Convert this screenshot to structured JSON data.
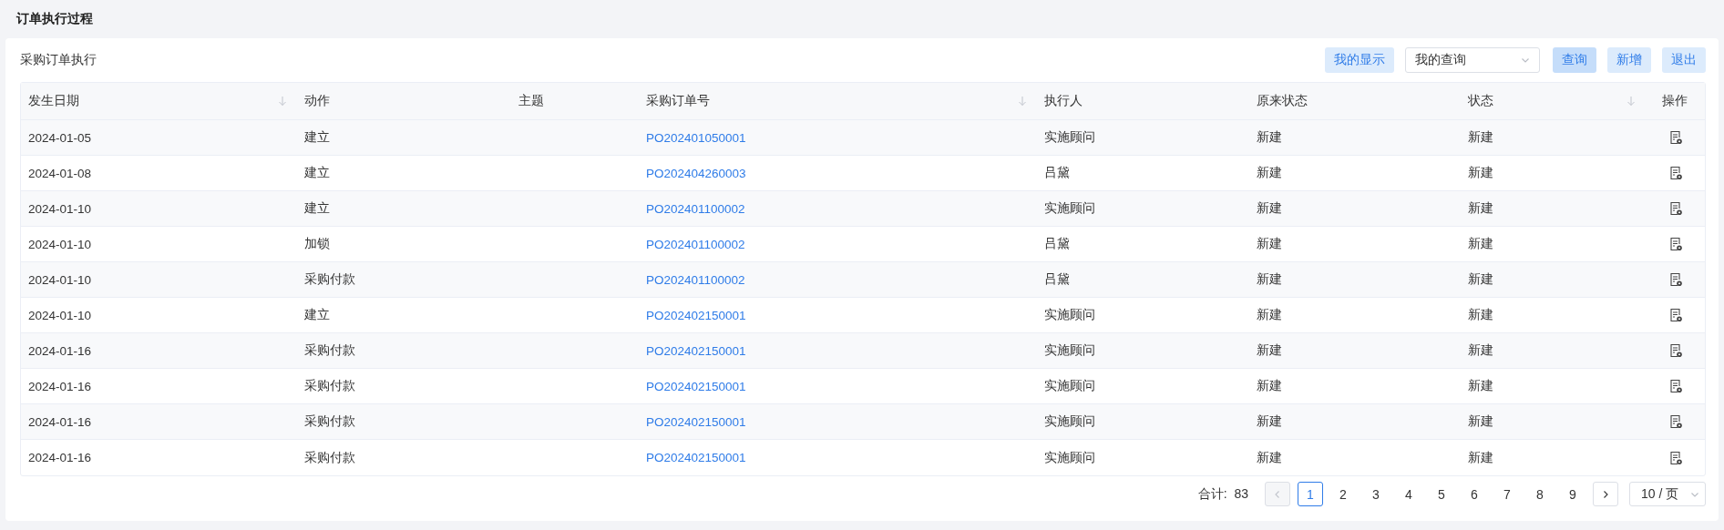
{
  "page_title": "订单执行过程",
  "panel": {
    "title": "采购订单执行",
    "toolbar": [
      {
        "kind": "button",
        "label": "我的显示",
        "selected": false
      },
      {
        "kind": "select",
        "value": "我的查询"
      },
      {
        "kind": "button",
        "label": "查询",
        "selected": true
      },
      {
        "kind": "button",
        "label": "新增",
        "selected": false
      },
      {
        "kind": "button",
        "label": "退出",
        "selected": false
      }
    ]
  },
  "table": {
    "columns": [
      {
        "label": "发生日期",
        "sortable": true
      },
      {
        "label": "动作",
        "sortable": false
      },
      {
        "label": "主题",
        "sortable": false
      },
      {
        "label": "采购订单号",
        "sortable": true
      },
      {
        "label": "执行人",
        "sortable": false
      },
      {
        "label": "原来状态",
        "sortable": false
      },
      {
        "label": "状态",
        "sortable": true
      },
      {
        "label": "操作",
        "sortable": false
      }
    ],
    "rows": [
      {
        "date": "2024-01-05",
        "action": "建立",
        "order_no": "PO202401050001",
        "executor": "实施顾问",
        "previous_status": "新建",
        "status": "新建"
      },
      {
        "date": "2024-01-08",
        "action": "建立",
        "order_no": "PO202404260003",
        "executor": "吕黛",
        "previous_status": "新建",
        "status": "新建"
      },
      {
        "date": "2024-01-10",
        "action": "建立",
        "order_no": "PO202401100002",
        "executor": "实施顾问",
        "previous_status": "新建",
        "status": "新建"
      },
      {
        "date": "2024-01-10",
        "action": "加锁",
        "order_no": "PO202401100002",
        "executor": "吕黛",
        "previous_status": "新建",
        "status": "新建"
      },
      {
        "date": "2024-01-10",
        "action": "采购付款",
        "order_no": "PO202401100002",
        "executor": "吕黛",
        "previous_status": "新建",
        "status": "新建"
      },
      {
        "date": "2024-01-10",
        "action": "建立",
        "order_no": "PO202402150001",
        "executor": "实施顾问",
        "previous_status": "新建",
        "status": "新建"
      },
      {
        "date": "2024-01-16",
        "action": "采购付款",
        "order_no": "PO202402150001",
        "executor": "实施顾问",
        "previous_status": "新建",
        "status": "新建"
      },
      {
        "date": "2024-01-16",
        "action": "采购付款",
        "order_no": "PO202402150001",
        "executor": "实施顾问",
        "previous_status": "新建",
        "status": "新建"
      },
      {
        "date": "2024-01-16",
        "action": "采购付款",
        "order_no": "PO202402150001",
        "executor": "实施顾问",
        "previous_status": "新建",
        "status": "新建"
      },
      {
        "date": "2024-01-16",
        "action": "采购付款",
        "order_no": "PO202402150001",
        "executor": "实施顾问",
        "previous_status": "新建",
        "status": "新建"
      }
    ]
  },
  "pagination": {
    "total_label": "合计:",
    "total": "83",
    "prev_disabled": true,
    "next_disabled": false,
    "pages": [
      {
        "label": "1",
        "selected": true
      },
      {
        "label": "2",
        "selected": false
      },
      {
        "label": "3",
        "selected": false
      },
      {
        "label": "4",
        "selected": false
      },
      {
        "label": "5",
        "selected": false
      },
      {
        "label": "6",
        "selected": false
      },
      {
        "label": "7",
        "selected": false
      },
      {
        "label": "8",
        "selected": false
      },
      {
        "label": "9",
        "selected": false
      }
    ],
    "page_size": "10 / 页"
  }
}
